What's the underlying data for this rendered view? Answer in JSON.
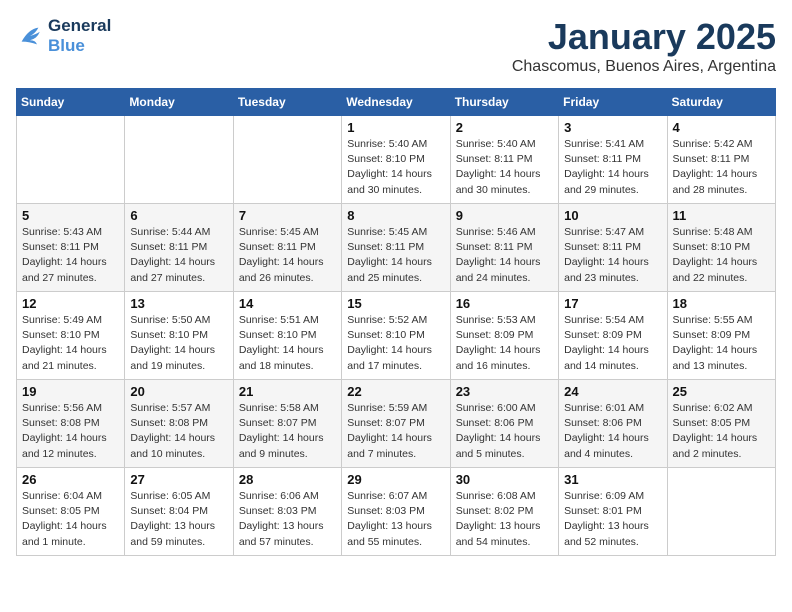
{
  "logo": {
    "line1": "General",
    "line2": "Blue"
  },
  "title": "January 2025",
  "subtitle": "Chascomus, Buenos Aires, Argentina",
  "headers": [
    "Sunday",
    "Monday",
    "Tuesday",
    "Wednesday",
    "Thursday",
    "Friday",
    "Saturday"
  ],
  "weeks": [
    [
      {
        "day": "",
        "info": ""
      },
      {
        "day": "",
        "info": ""
      },
      {
        "day": "",
        "info": ""
      },
      {
        "day": "1",
        "info": "Sunrise: 5:40 AM\nSunset: 8:10 PM\nDaylight: 14 hours\nand 30 minutes."
      },
      {
        "day": "2",
        "info": "Sunrise: 5:40 AM\nSunset: 8:11 PM\nDaylight: 14 hours\nand 30 minutes."
      },
      {
        "day": "3",
        "info": "Sunrise: 5:41 AM\nSunset: 8:11 PM\nDaylight: 14 hours\nand 29 minutes."
      },
      {
        "day": "4",
        "info": "Sunrise: 5:42 AM\nSunset: 8:11 PM\nDaylight: 14 hours\nand 28 minutes."
      }
    ],
    [
      {
        "day": "5",
        "info": "Sunrise: 5:43 AM\nSunset: 8:11 PM\nDaylight: 14 hours\nand 27 minutes."
      },
      {
        "day": "6",
        "info": "Sunrise: 5:44 AM\nSunset: 8:11 PM\nDaylight: 14 hours\nand 27 minutes."
      },
      {
        "day": "7",
        "info": "Sunrise: 5:45 AM\nSunset: 8:11 PM\nDaylight: 14 hours\nand 26 minutes."
      },
      {
        "day": "8",
        "info": "Sunrise: 5:45 AM\nSunset: 8:11 PM\nDaylight: 14 hours\nand 25 minutes."
      },
      {
        "day": "9",
        "info": "Sunrise: 5:46 AM\nSunset: 8:11 PM\nDaylight: 14 hours\nand 24 minutes."
      },
      {
        "day": "10",
        "info": "Sunrise: 5:47 AM\nSunset: 8:11 PM\nDaylight: 14 hours\nand 23 minutes."
      },
      {
        "day": "11",
        "info": "Sunrise: 5:48 AM\nSunset: 8:10 PM\nDaylight: 14 hours\nand 22 minutes."
      }
    ],
    [
      {
        "day": "12",
        "info": "Sunrise: 5:49 AM\nSunset: 8:10 PM\nDaylight: 14 hours\nand 21 minutes."
      },
      {
        "day": "13",
        "info": "Sunrise: 5:50 AM\nSunset: 8:10 PM\nDaylight: 14 hours\nand 19 minutes."
      },
      {
        "day": "14",
        "info": "Sunrise: 5:51 AM\nSunset: 8:10 PM\nDaylight: 14 hours\nand 18 minutes."
      },
      {
        "day": "15",
        "info": "Sunrise: 5:52 AM\nSunset: 8:10 PM\nDaylight: 14 hours\nand 17 minutes."
      },
      {
        "day": "16",
        "info": "Sunrise: 5:53 AM\nSunset: 8:09 PM\nDaylight: 14 hours\nand 16 minutes."
      },
      {
        "day": "17",
        "info": "Sunrise: 5:54 AM\nSunset: 8:09 PM\nDaylight: 14 hours\nand 14 minutes."
      },
      {
        "day": "18",
        "info": "Sunrise: 5:55 AM\nSunset: 8:09 PM\nDaylight: 14 hours\nand 13 minutes."
      }
    ],
    [
      {
        "day": "19",
        "info": "Sunrise: 5:56 AM\nSunset: 8:08 PM\nDaylight: 14 hours\nand 12 minutes."
      },
      {
        "day": "20",
        "info": "Sunrise: 5:57 AM\nSunset: 8:08 PM\nDaylight: 14 hours\nand 10 minutes."
      },
      {
        "day": "21",
        "info": "Sunrise: 5:58 AM\nSunset: 8:07 PM\nDaylight: 14 hours\nand 9 minutes."
      },
      {
        "day": "22",
        "info": "Sunrise: 5:59 AM\nSunset: 8:07 PM\nDaylight: 14 hours\nand 7 minutes."
      },
      {
        "day": "23",
        "info": "Sunrise: 6:00 AM\nSunset: 8:06 PM\nDaylight: 14 hours\nand 5 minutes."
      },
      {
        "day": "24",
        "info": "Sunrise: 6:01 AM\nSunset: 8:06 PM\nDaylight: 14 hours\nand 4 minutes."
      },
      {
        "day": "25",
        "info": "Sunrise: 6:02 AM\nSunset: 8:05 PM\nDaylight: 14 hours\nand 2 minutes."
      }
    ],
    [
      {
        "day": "26",
        "info": "Sunrise: 6:04 AM\nSunset: 8:05 PM\nDaylight: 14 hours\nand 1 minute."
      },
      {
        "day": "27",
        "info": "Sunrise: 6:05 AM\nSunset: 8:04 PM\nDaylight: 13 hours\nand 59 minutes."
      },
      {
        "day": "28",
        "info": "Sunrise: 6:06 AM\nSunset: 8:03 PM\nDaylight: 13 hours\nand 57 minutes."
      },
      {
        "day": "29",
        "info": "Sunrise: 6:07 AM\nSunset: 8:03 PM\nDaylight: 13 hours\nand 55 minutes."
      },
      {
        "day": "30",
        "info": "Sunrise: 6:08 AM\nSunset: 8:02 PM\nDaylight: 13 hours\nand 54 minutes."
      },
      {
        "day": "31",
        "info": "Sunrise: 6:09 AM\nSunset: 8:01 PM\nDaylight: 13 hours\nand 52 minutes."
      },
      {
        "day": "",
        "info": ""
      }
    ]
  ]
}
